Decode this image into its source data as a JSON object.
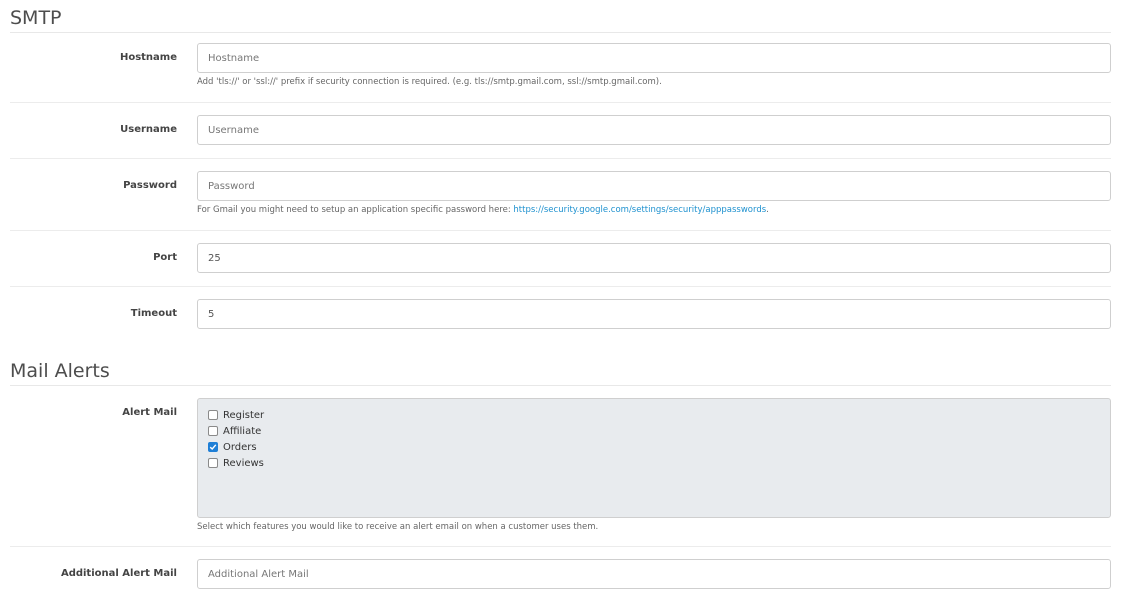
{
  "smtp": {
    "heading": "SMTP",
    "hostname": {
      "label": "Hostname",
      "placeholder": "Hostname",
      "value": "",
      "help": "Add 'tls://' or 'ssl://' prefix if security connection is required. (e.g. tls://smtp.gmail.com, ssl://smtp.gmail.com)."
    },
    "username": {
      "label": "Username",
      "placeholder": "Username",
      "value": ""
    },
    "password": {
      "label": "Password",
      "placeholder": "Password",
      "value": "",
      "help_prefix": "For Gmail you might need to setup an application specific password here: ",
      "help_link": "https://security.google.com/settings/security/apppasswords",
      "help_suffix": "."
    },
    "port": {
      "label": "Port",
      "value": "25"
    },
    "timeout": {
      "label": "Timeout",
      "value": "5"
    }
  },
  "mail_alerts": {
    "heading": "Mail Alerts",
    "alert_mail": {
      "label": "Alert Mail",
      "options": [
        {
          "label": "Register",
          "checked": false
        },
        {
          "label": "Affiliate",
          "checked": false
        },
        {
          "label": "Orders",
          "checked": true
        },
        {
          "label": "Reviews",
          "checked": false
        }
      ],
      "help": "Select which features you would like to receive an alert email on when a customer uses them."
    },
    "additional_alert_mail": {
      "label": "Additional Alert Mail",
      "placeholder": "Additional Alert Mail",
      "value": ""
    }
  },
  "colors": {
    "link": "#1e91cf",
    "checkbox_checked": "#1f7fd6",
    "well_bg": "#e8ebee"
  }
}
